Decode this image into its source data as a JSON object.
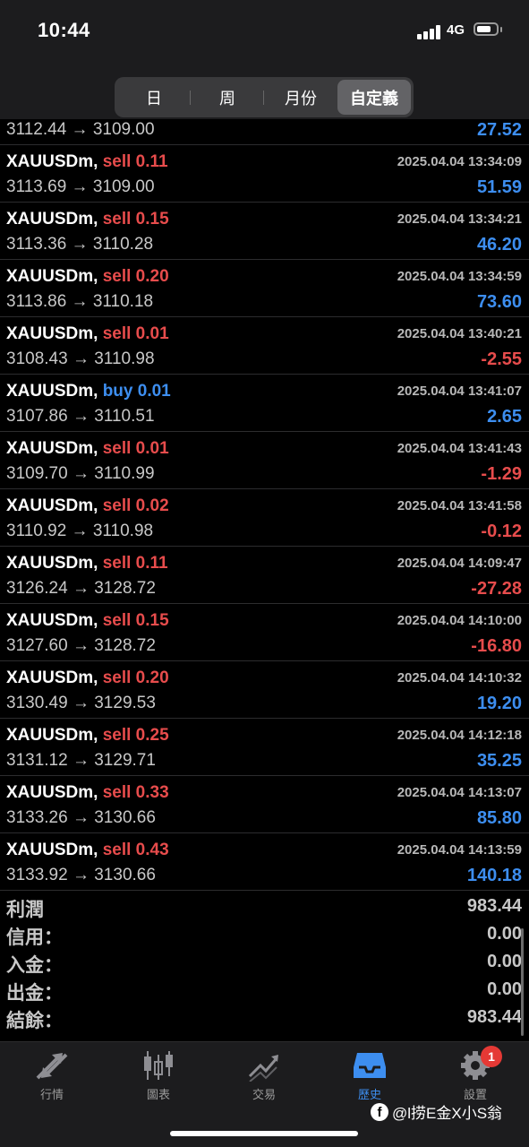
{
  "status": {
    "time": "10:44",
    "network": "4G"
  },
  "segment": {
    "tabs": [
      "日",
      "周",
      "月份",
      "自定義"
    ],
    "active": "自定義"
  },
  "trades": [
    {
      "symbol": "XAUUSDm,",
      "side": "sell",
      "volume": "0.11",
      "date": "2025.04.04 13:34:09",
      "prices": "3113.69 → 3109.00",
      "profit": "51.59",
      "positive": true
    },
    {
      "symbol": "XAUUSDm,",
      "side": "sell",
      "volume": "0.15",
      "date": "2025.04.04 13:34:21",
      "prices": "3113.36 → 3110.28",
      "profit": "46.20",
      "positive": true
    },
    {
      "symbol": "XAUUSDm,",
      "side": "sell",
      "volume": "0.20",
      "date": "2025.04.04 13:34:59",
      "prices": "3113.86 → 3110.18",
      "profit": "73.60",
      "positive": true
    },
    {
      "symbol": "XAUUSDm,",
      "side": "sell",
      "volume": "0.01",
      "date": "2025.04.04 13:40:21",
      "prices": "3108.43 → 3110.98",
      "profit": "-2.55",
      "positive": false
    },
    {
      "symbol": "XAUUSDm,",
      "side": "buy",
      "volume": "0.01",
      "date": "2025.04.04 13:41:07",
      "prices": "3107.86 → 3110.51",
      "profit": "2.65",
      "positive": true
    },
    {
      "symbol": "XAUUSDm,",
      "side": "sell",
      "volume": "0.01",
      "date": "2025.04.04 13:41:43",
      "prices": "3109.70 → 3110.99",
      "profit": "-1.29",
      "positive": false
    },
    {
      "symbol": "XAUUSDm,",
      "side": "sell",
      "volume": "0.02",
      "date": "2025.04.04 13:41:58",
      "prices": "3110.92 → 3110.98",
      "profit": "-0.12",
      "positive": false
    },
    {
      "symbol": "XAUUSDm,",
      "side": "sell",
      "volume": "0.11",
      "date": "2025.04.04 14:09:47",
      "prices": "3126.24 → 3128.72",
      "profit": "-27.28",
      "positive": false
    },
    {
      "symbol": "XAUUSDm,",
      "side": "sell",
      "volume": "0.15",
      "date": "2025.04.04 14:10:00",
      "prices": "3127.60 → 3128.72",
      "profit": "-16.80",
      "positive": false
    },
    {
      "symbol": "XAUUSDm,",
      "side": "sell",
      "volume": "0.20",
      "date": "2025.04.04 14:10:32",
      "prices": "3130.49 → 3129.53",
      "profit": "19.20",
      "positive": true
    },
    {
      "symbol": "XAUUSDm,",
      "side": "sell",
      "volume": "0.25",
      "date": "2025.04.04 14:12:18",
      "prices": "3131.12 → 3129.71",
      "profit": "35.25",
      "positive": true
    },
    {
      "symbol": "XAUUSDm,",
      "side": "sell",
      "volume": "0.33",
      "date": "2025.04.04 14:13:07",
      "prices": "3133.26 → 3130.66",
      "profit": "85.80",
      "positive": true
    },
    {
      "symbol": "XAUUSDm,",
      "side": "sell",
      "volume": "0.43",
      "date": "2025.04.04 14:13:59",
      "prices": "3133.92 → 3130.66",
      "profit": "140.18",
      "positive": true
    }
  ],
  "partial_row": {
    "prices": "3112.44 → 3109.00",
    "profit": "27.52"
  },
  "summary": [
    {
      "label": "利潤",
      "value": "983.44"
    },
    {
      "label": "信用：",
      "value": "0.00"
    },
    {
      "label": "入金：",
      "value": "0.00"
    },
    {
      "label": "出金：",
      "value": "0.00"
    },
    {
      "label": "結餘：",
      "value": "983.44"
    }
  ],
  "tabbar": [
    {
      "label": "行情",
      "icon": "quotes-arrows-icon"
    },
    {
      "label": "圖表",
      "icon": "candlestick-chart-icon"
    },
    {
      "label": "交易",
      "icon": "trade-trend-icon"
    },
    {
      "label": "歷史",
      "icon": "history-inbox-icon",
      "active": true
    },
    {
      "label": "設置",
      "icon": "gear-icon",
      "badge": "1"
    }
  ],
  "watermark": {
    "icon_letter": "f",
    "text": "@l捞E金X小S翁"
  },
  "colors": {
    "sell": "#e74c4c",
    "buy": "#3d8ef0",
    "profit_positive": "#3d8ef0",
    "profit_negative": "#e74c4c",
    "active_tab": "#3d8ef0"
  }
}
